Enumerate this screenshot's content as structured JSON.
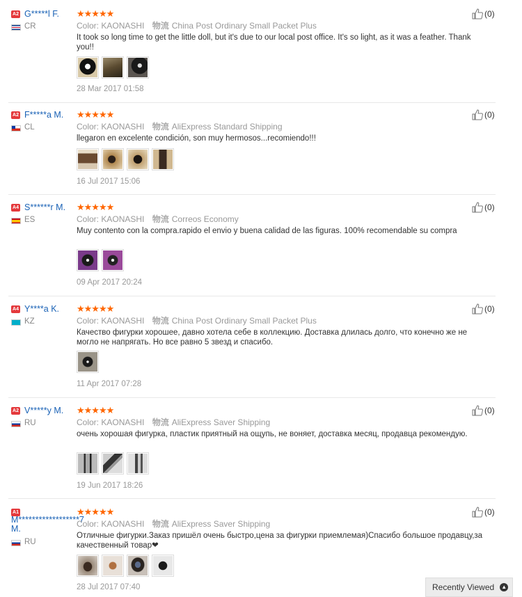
{
  "labels": {
    "color_label": "Color:",
    "logistics_glyph": "物流"
  },
  "reviews": [
    {
      "badge": "A2",
      "name": "G*****l F.",
      "country": "CR",
      "stars": "★★★★★",
      "color": "KAONASHI",
      "shipping": "China Post Ordinary Small Packet Plus",
      "text": "It took so long time to get the little doll, but it's due to our local post office. It's so light, as it was a feather. Thank you!!",
      "date": "28 Mar 2017 01:58",
      "likes": "(0)"
    },
    {
      "badge": "A2",
      "name": "F*****a M.",
      "country": "CL",
      "stars": "★★★★★",
      "color": "KAONASHI",
      "shipping": "AliExpress Standard Shipping",
      "text": "llegaron en excelente condición, son muy hermosos...recomiendo!!!",
      "date": "16 Jul 2017 15:06",
      "likes": "(0)"
    },
    {
      "badge": "A4",
      "name": "S******r M.",
      "country": "ES",
      "stars": "★★★★★",
      "color": "KAONASHI",
      "shipping": "Correos Economy",
      "text": "Muy contento con la compra.rapido el envio y buena calidad de las figuras. 100% recomendable su compra",
      "date": "09 Apr 2017 20:24",
      "likes": "(0)"
    },
    {
      "badge": "A4",
      "name": "Y****a K.",
      "country": "KZ",
      "stars": "★★★★★",
      "color": "KAONASHI",
      "shipping": "China Post Ordinary Small Packet Plus",
      "text": "Качество фигурки хорошее, давно хотела себе в коллекцию. Доставка длилась долго, что конечно же не могло не напрягать. Но все равно 5 звезд и спасибо.",
      "date": "11 Apr 2017 07:28",
      "likes": "(0)"
    },
    {
      "badge": "A2",
      "name": "V*****y M.",
      "country": "RU",
      "stars": "★★★★★",
      "color": "KAONASHI",
      "shipping": "AliExpress Saver Shipping",
      "text": "очень хорошая фигурка, пластик приятный на ощупь, не воняет, доставка месяц, продавца рекомендую.",
      "date": "19 Jun 2017 18:26",
      "likes": "(0)"
    },
    {
      "badge": "A1",
      "name": "M******************7 M.",
      "country": "RU",
      "stars": "★★★★★",
      "color": "KAONASHI",
      "shipping": "AliExpress Saver Shipping",
      "text": "Отличные фигурки.Заказ пришёл очень быстро,цена за фигурки приемлемая)Спасибо большое продавцу,за качественный товар❤",
      "date": "28 Jul 2017 07:40",
      "likes": "(0)"
    }
  ],
  "footer": {
    "recently_viewed": "Recently Viewed"
  }
}
